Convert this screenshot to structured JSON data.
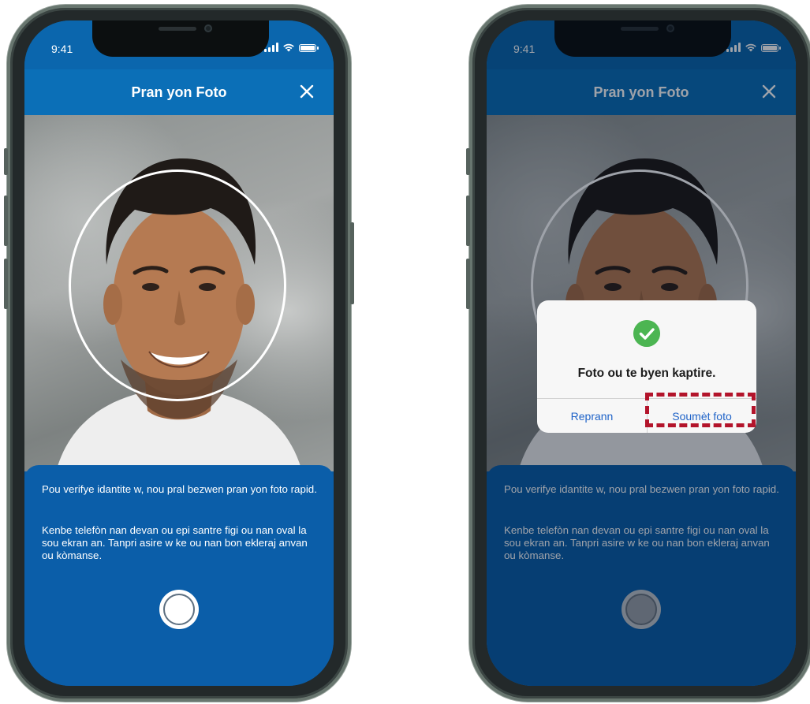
{
  "status_bar": {
    "time": "9:41"
  },
  "header": {
    "title": "Pran yon Foto",
    "close_icon": "close-icon"
  },
  "instructions": {
    "paragraph_1": "Pou verifye idantite w, nou pral bezwen pran yon foto rapid.",
    "paragraph_2": "Kenbe telefòn nan devan ou epi santre figi ou nan oval la sou ekran an. Tanpri asire w ke ou nan bon ekleraj anvan ou kòmanse."
  },
  "dialog": {
    "message": "Foto ou te byen kaptire.",
    "icon": "check-circle-icon",
    "retake_label": "Reprann",
    "submit_label": "Soumèt foto"
  },
  "colors": {
    "header_blue": "#0b6fb7",
    "panel_blue": "#0b5ea9",
    "success_green": "#4cb552",
    "link_blue": "#1f63c8",
    "highlight_red": "#b3142b"
  }
}
